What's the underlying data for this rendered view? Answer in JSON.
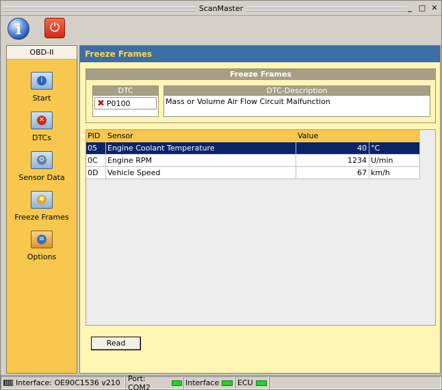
{
  "window": {
    "title": "ScanMaster",
    "controls": [
      "minimize-icon",
      "maximize-icon",
      "close-icon"
    ],
    "minimize": "_",
    "maximize": "□",
    "close": "✕"
  },
  "toolbar": {
    "info_icon": "i",
    "power_icon": "⏻"
  },
  "sidebar": {
    "header": "OBD-II",
    "items": [
      {
        "label": "Start",
        "icon": "info-icon"
      },
      {
        "label": "DTCs",
        "icon": "dtc-icon"
      },
      {
        "label": "Sensor Data",
        "icon": "gear-icon"
      },
      {
        "label": "Freeze Frames",
        "icon": "freeze-frame-icon"
      },
      {
        "label": "Options",
        "icon": "options-icon"
      }
    ]
  },
  "main": {
    "header": "Freeze Frames",
    "freeze_frames": {
      "caption": "Freeze Frames",
      "dtc_header": "DTC",
      "dtc_code": "P0100",
      "desc_header": "DTC-Description",
      "description": "Mass or Volume Air Flow Circuit Malfunction"
    },
    "table": {
      "columns": [
        "PID",
        "Sensor",
        "Value",
        ""
      ],
      "rows": [
        {
          "pid": "05",
          "sensor": "Engine Coolant Temperature",
          "value": "40",
          "unit": "°C",
          "selected": true
        },
        {
          "pid": "0C",
          "sensor": "Engine RPM",
          "value": "1234",
          "unit": "U/min",
          "selected": false
        },
        {
          "pid": "0D",
          "sensor": "Vehicle Speed",
          "value": "67",
          "unit": "km/h",
          "selected": false
        }
      ]
    },
    "read_button": "Read"
  },
  "statusbar": {
    "interface": "Interface: OE90C1536 v210",
    "port": "Port: COM2",
    "interface_label": "Interface",
    "ecu": "ECU",
    "led_color": "#27d22c"
  },
  "colors": {
    "header_bg": "#3b6ea5",
    "header_text": "#ffd34e",
    "sidebar_bg": "#f7c84d",
    "content_bg": "#fff6b6",
    "selected_row": "#0a246a"
  }
}
